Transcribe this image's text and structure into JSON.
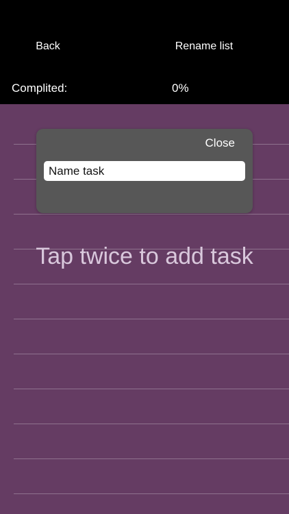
{
  "colors": {
    "header_background": "#000000",
    "notebook_background": "#653C63",
    "dialog_background": "#575757",
    "status_indicator": "#E8293A",
    "hint_text": "#D9C8DC"
  },
  "header": {
    "back_label": "Back",
    "rename_label": "Rename list",
    "completed_label": "Complited:",
    "completed_value": "0%"
  },
  "dialog": {
    "close_label": "Close",
    "task_input_value": "Name task",
    "task_input_placeholder": "Name task"
  },
  "notebook": {
    "hint": "Tap twice to add task"
  }
}
